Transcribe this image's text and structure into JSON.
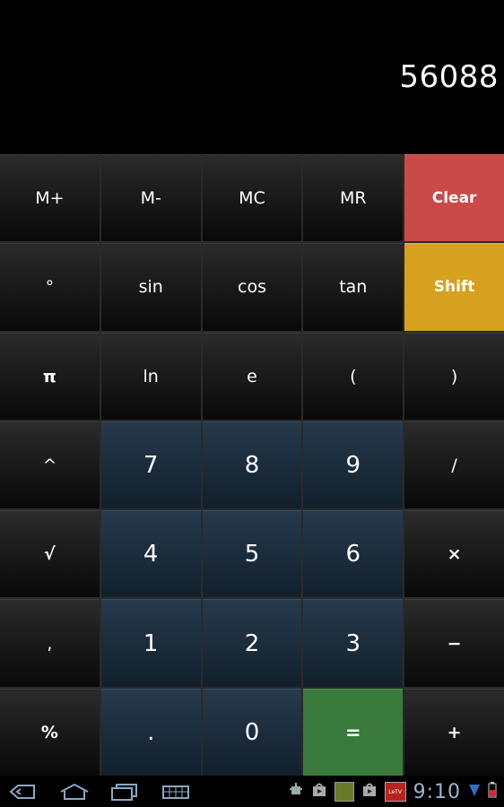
{
  "display": {
    "value": "56088"
  },
  "keys": [
    {
      "label": "M+",
      "name": "memory-add-button",
      "style": "fn"
    },
    {
      "label": "M-",
      "name": "memory-subtract-button",
      "style": "fn"
    },
    {
      "label": "MC",
      "name": "memory-clear-button",
      "style": "fn"
    },
    {
      "label": "MR",
      "name": "memory-recall-button",
      "style": "fn"
    },
    {
      "label": "Clear",
      "name": "clear-button",
      "style": "red"
    },
    {
      "label": "°",
      "name": "degree-button",
      "style": "fn"
    },
    {
      "label": "sin",
      "name": "sin-button",
      "style": "fn"
    },
    {
      "label": "cos",
      "name": "cos-button",
      "style": "fn"
    },
    {
      "label": "tan",
      "name": "tan-button",
      "style": "fn"
    },
    {
      "label": "Shift",
      "name": "shift-button",
      "style": "yellow"
    },
    {
      "label": "π",
      "name": "pi-button",
      "style": "fn bold"
    },
    {
      "label": "ln",
      "name": "ln-button",
      "style": "fn"
    },
    {
      "label": "e",
      "name": "e-button",
      "style": "fn"
    },
    {
      "label": "(",
      "name": "open-paren-button",
      "style": "fn"
    },
    {
      "label": ")",
      "name": "close-paren-button",
      "style": "fn"
    },
    {
      "label": "^",
      "name": "power-button",
      "style": "fn"
    },
    {
      "label": "7",
      "name": "digit-7-button",
      "style": "num"
    },
    {
      "label": "8",
      "name": "digit-8-button",
      "style": "num"
    },
    {
      "label": "9",
      "name": "digit-9-button",
      "style": "num"
    },
    {
      "label": "/",
      "name": "divide-button",
      "style": "fn"
    },
    {
      "label": "√",
      "name": "sqrt-button",
      "style": "fn bold"
    },
    {
      "label": "4",
      "name": "digit-4-button",
      "style": "num"
    },
    {
      "label": "5",
      "name": "digit-5-button",
      "style": "num"
    },
    {
      "label": "6",
      "name": "digit-6-button",
      "style": "num"
    },
    {
      "label": "×",
      "name": "multiply-button",
      "style": "fn bold"
    },
    {
      "label": ",",
      "name": "comma-button",
      "style": "fn"
    },
    {
      "label": "1",
      "name": "digit-1-button",
      "style": "num"
    },
    {
      "label": "2",
      "name": "digit-2-button",
      "style": "num"
    },
    {
      "label": "3",
      "name": "digit-3-button",
      "style": "num"
    },
    {
      "label": "−",
      "name": "minus-button",
      "style": "fn bold"
    },
    {
      "label": "%",
      "name": "percent-button",
      "style": "fn bold"
    },
    {
      "label": ".",
      "name": "decimal-button",
      "style": "num"
    },
    {
      "label": "0",
      "name": "digit-0-button",
      "style": "num"
    },
    {
      "label": "=",
      "name": "equals-button",
      "style": "green"
    },
    {
      "label": "+",
      "name": "plus-button",
      "style": "fn bold"
    }
  ],
  "status_bar": {
    "time": "9:10",
    "notification_badge": "LeTV"
  },
  "colors": {
    "clear": "#c94a47",
    "shift": "#d6a11f",
    "equals": "#3a7a3c",
    "number_keys": "#1b2c3c",
    "function_keys": "#1b1b1b"
  }
}
